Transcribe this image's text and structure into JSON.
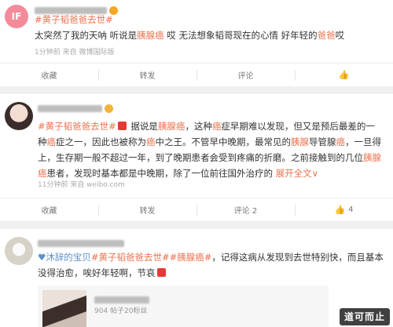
{
  "post1": {
    "avatar_text": "IF",
    "hashtag": "#黄子韬爸爸去世#",
    "text_a": "太突然了我的天呐 听说是",
    "kw1": "胰腺癌",
    "text_b": " 哎 无法想象韬哥现在的心情 好年轻的",
    "kw2": "爸爸",
    "text_c": "哎",
    "meta": "1分钟前  来自 微博国际版",
    "actions": [
      "收藏",
      "转发",
      "评论"
    ]
  },
  "post2": {
    "hashtag": "#黄子韬爸爸去世#",
    "t1": " 据说是",
    "k1": "胰腺癌",
    "t2": "，这种",
    "k2": "癌",
    "t3": "症早期难以发现，但又是预后最差的一种",
    "k3": "癌",
    "t4": "症之一，因此也被称为",
    "k4": "癌",
    "t5": "中之王。不管早中晚期，最常见的",
    "k5": "胰腺",
    "t6": "导管腺",
    "k6": "癌",
    "t7": "，一旦得上，生存期一般不超过一年，到了晚期患者会受到疼痛的折磨。之前接触到的几位",
    "k7": "胰腺癌",
    "t8": "患者，发现时基本都是中晚期，除了一位前往国外治疗的",
    "expand": "展开全文∨",
    "meta": "11分钟前  来自 weibo.com",
    "actions": [
      "收藏",
      "转发",
      "评论 2",
      "4"
    ]
  },
  "post3": {
    "username_prefix": "♥沐辞的宝贝",
    "hashtag1": "#黄子韬爸爸去世#",
    "hashtag2": "#胰腺癌#",
    "t1": "，记得这病从发现到去世特别快，而且基本没得治愈，唉好年轻啊，节哀",
    "quote_meta": "904 帖子20粉丝"
  },
  "watermark": "道可而止"
}
